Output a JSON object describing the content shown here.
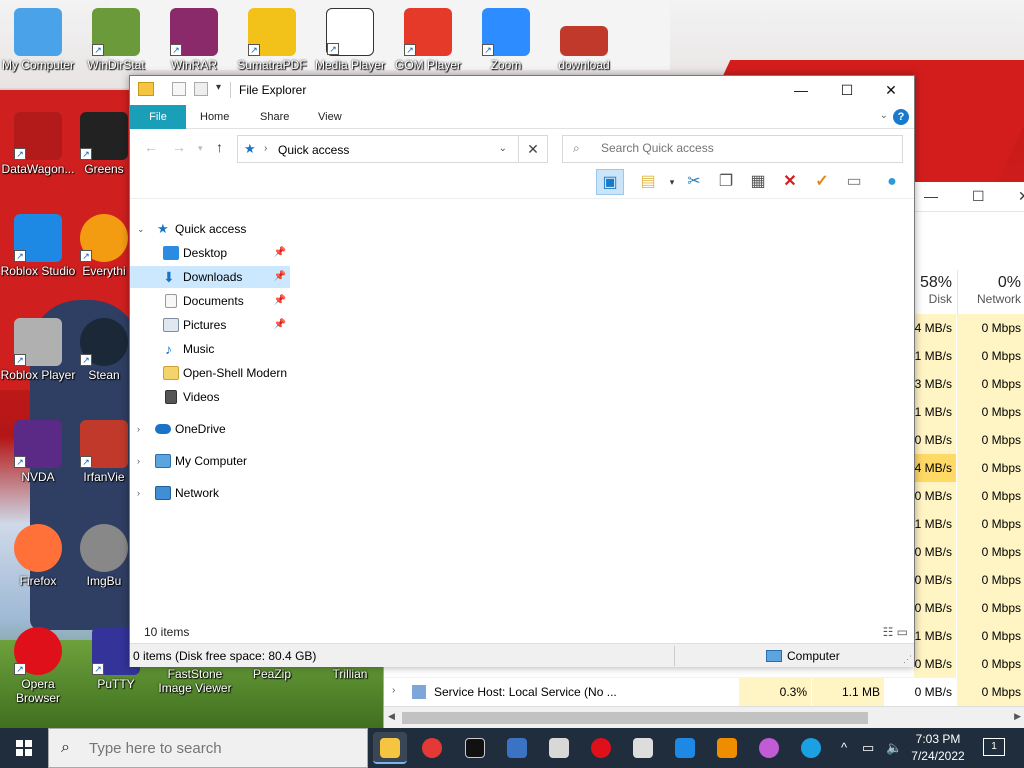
{
  "desktop": {
    "icons_row1": [
      {
        "label": "My Computer",
        "color": "#4aa3e8",
        "icon": "computer-icon"
      },
      {
        "label": "WinDirStat",
        "color": "#6a9a3a",
        "icon": "tree-icon"
      },
      {
        "label": "WinRAR",
        "color": "#8b2a6b",
        "icon": "winrar-icon"
      },
      {
        "label": "SumatraPDF",
        "color": "#f2c21a",
        "icon": "pdf-icon"
      },
      {
        "label": "Media Player",
        "color": "#ffffff",
        "icon": "clapper-icon"
      },
      {
        "label": "GOM Player",
        "color": "#e53a2a",
        "icon": "gom-icon"
      },
      {
        "label": "Zoom",
        "color": "#2d8cff",
        "icon": "zoom-icon"
      },
      {
        "label": "download",
        "color": "#c0392b",
        "icon": "roblox-logo-icon"
      }
    ],
    "icons_col": [
      {
        "label": "DataWagon...",
        "color": "#b31b1b",
        "icon": "datawagon-icon"
      },
      {
        "label": "Greens",
        "color": "#222222",
        "icon": "greenshot-icon"
      },
      {
        "label": "Roblox Studio",
        "color": "#1e88e5",
        "icon": "roblox-studio-icon"
      },
      {
        "label": "Everythi",
        "color": "#f39c12",
        "icon": "search-everything-icon"
      },
      {
        "label": "Roblox Player",
        "color": "#b0b0b0",
        "icon": "roblox-player-icon"
      },
      {
        "label": "Stean",
        "color": "#1b2838",
        "icon": "steam-icon"
      },
      {
        "label": "NVDA",
        "color": "#5b2a86",
        "icon": "nvda-icon"
      },
      {
        "label": "IrfanVie",
        "color": "#c0392b",
        "icon": "irfanview-icon"
      },
      {
        "label": "Firefox",
        "color": "#ff7139",
        "icon": "firefox-icon"
      },
      {
        "label": "ImgBu",
        "color": "#888888",
        "icon": "imgburn-icon"
      },
      {
        "label": "Opera Browser",
        "color": "#e0101b",
        "icon": "opera-icon"
      },
      {
        "label": "PuTTY",
        "color": "#333399",
        "icon": "putty-icon"
      },
      {
        "label": "FastStone Image Viewer",
        "color": "#2e86c1",
        "icon": "faststone-icon"
      },
      {
        "label": "PeaZip",
        "color": "#3c8d2f",
        "icon": "peazip-icon"
      },
      {
        "label": "Trillian",
        "color": "#555555",
        "icon": "trillian-icon"
      }
    ]
  },
  "taskmgr": {
    "disk_pct": "58%",
    "disk_label": "Disk",
    "net_pct": "0%",
    "net_label": "Network",
    "rows": [
      {
        "disk": "4 MB/s",
        "net": "0 Mbps"
      },
      {
        "disk": "1 MB/s",
        "net": "0 Mbps"
      },
      {
        "disk": "3 MB/s",
        "net": "0 Mbps"
      },
      {
        "disk": "1 MB/s",
        "net": "0 Mbps"
      },
      {
        "disk": "0 MB/s",
        "net": "0 Mbps"
      },
      {
        "disk": "4 MB/s",
        "net": "0 Mbps"
      },
      {
        "disk": "0 MB/s",
        "net": "0 Mbps"
      },
      {
        "disk": "1 MB/s",
        "net": "0 Mbps"
      },
      {
        "disk": "0 MB/s",
        "net": "0 Mbps"
      },
      {
        "disk": "0 MB/s",
        "net": "0 Mbps"
      },
      {
        "disk": "0 MB/s",
        "net": "0 Mbps"
      },
      {
        "disk": "1 MB/s",
        "net": "0 Mbps"
      },
      {
        "disk": "0 MB/s",
        "net": "0 Mbps"
      }
    ],
    "last_row": {
      "name": "Service Host: Local Service (No ...",
      "cpu": "0.3%",
      "mem": "1.1 MB",
      "disk": "0 MB/s",
      "net": "0 Mbps"
    }
  },
  "explorer": {
    "title": "File Explorer",
    "tabs": {
      "file": "File",
      "home": "Home",
      "share": "Share",
      "view": "View"
    },
    "address": "Quick access",
    "search_placeholder": "Search Quick access",
    "nav": {
      "quick_access": "Quick access",
      "desktop": "Desktop",
      "downloads": "Downloads",
      "documents": "Documents",
      "pictures": "Pictures",
      "music": "Music",
      "openshell": "Open-Shell Modern",
      "videos": "Videos",
      "onedrive": "OneDrive",
      "mycomputer": "My Computer",
      "network": "Network"
    },
    "status_count": "10 items",
    "details_info": "0 items (Disk free space: 80.4 GB)",
    "details_location": "Computer"
  },
  "taskbar": {
    "search_placeholder": "Type here to search",
    "time": "7:03 PM",
    "date": "7/24/2022",
    "notifications": "1"
  }
}
